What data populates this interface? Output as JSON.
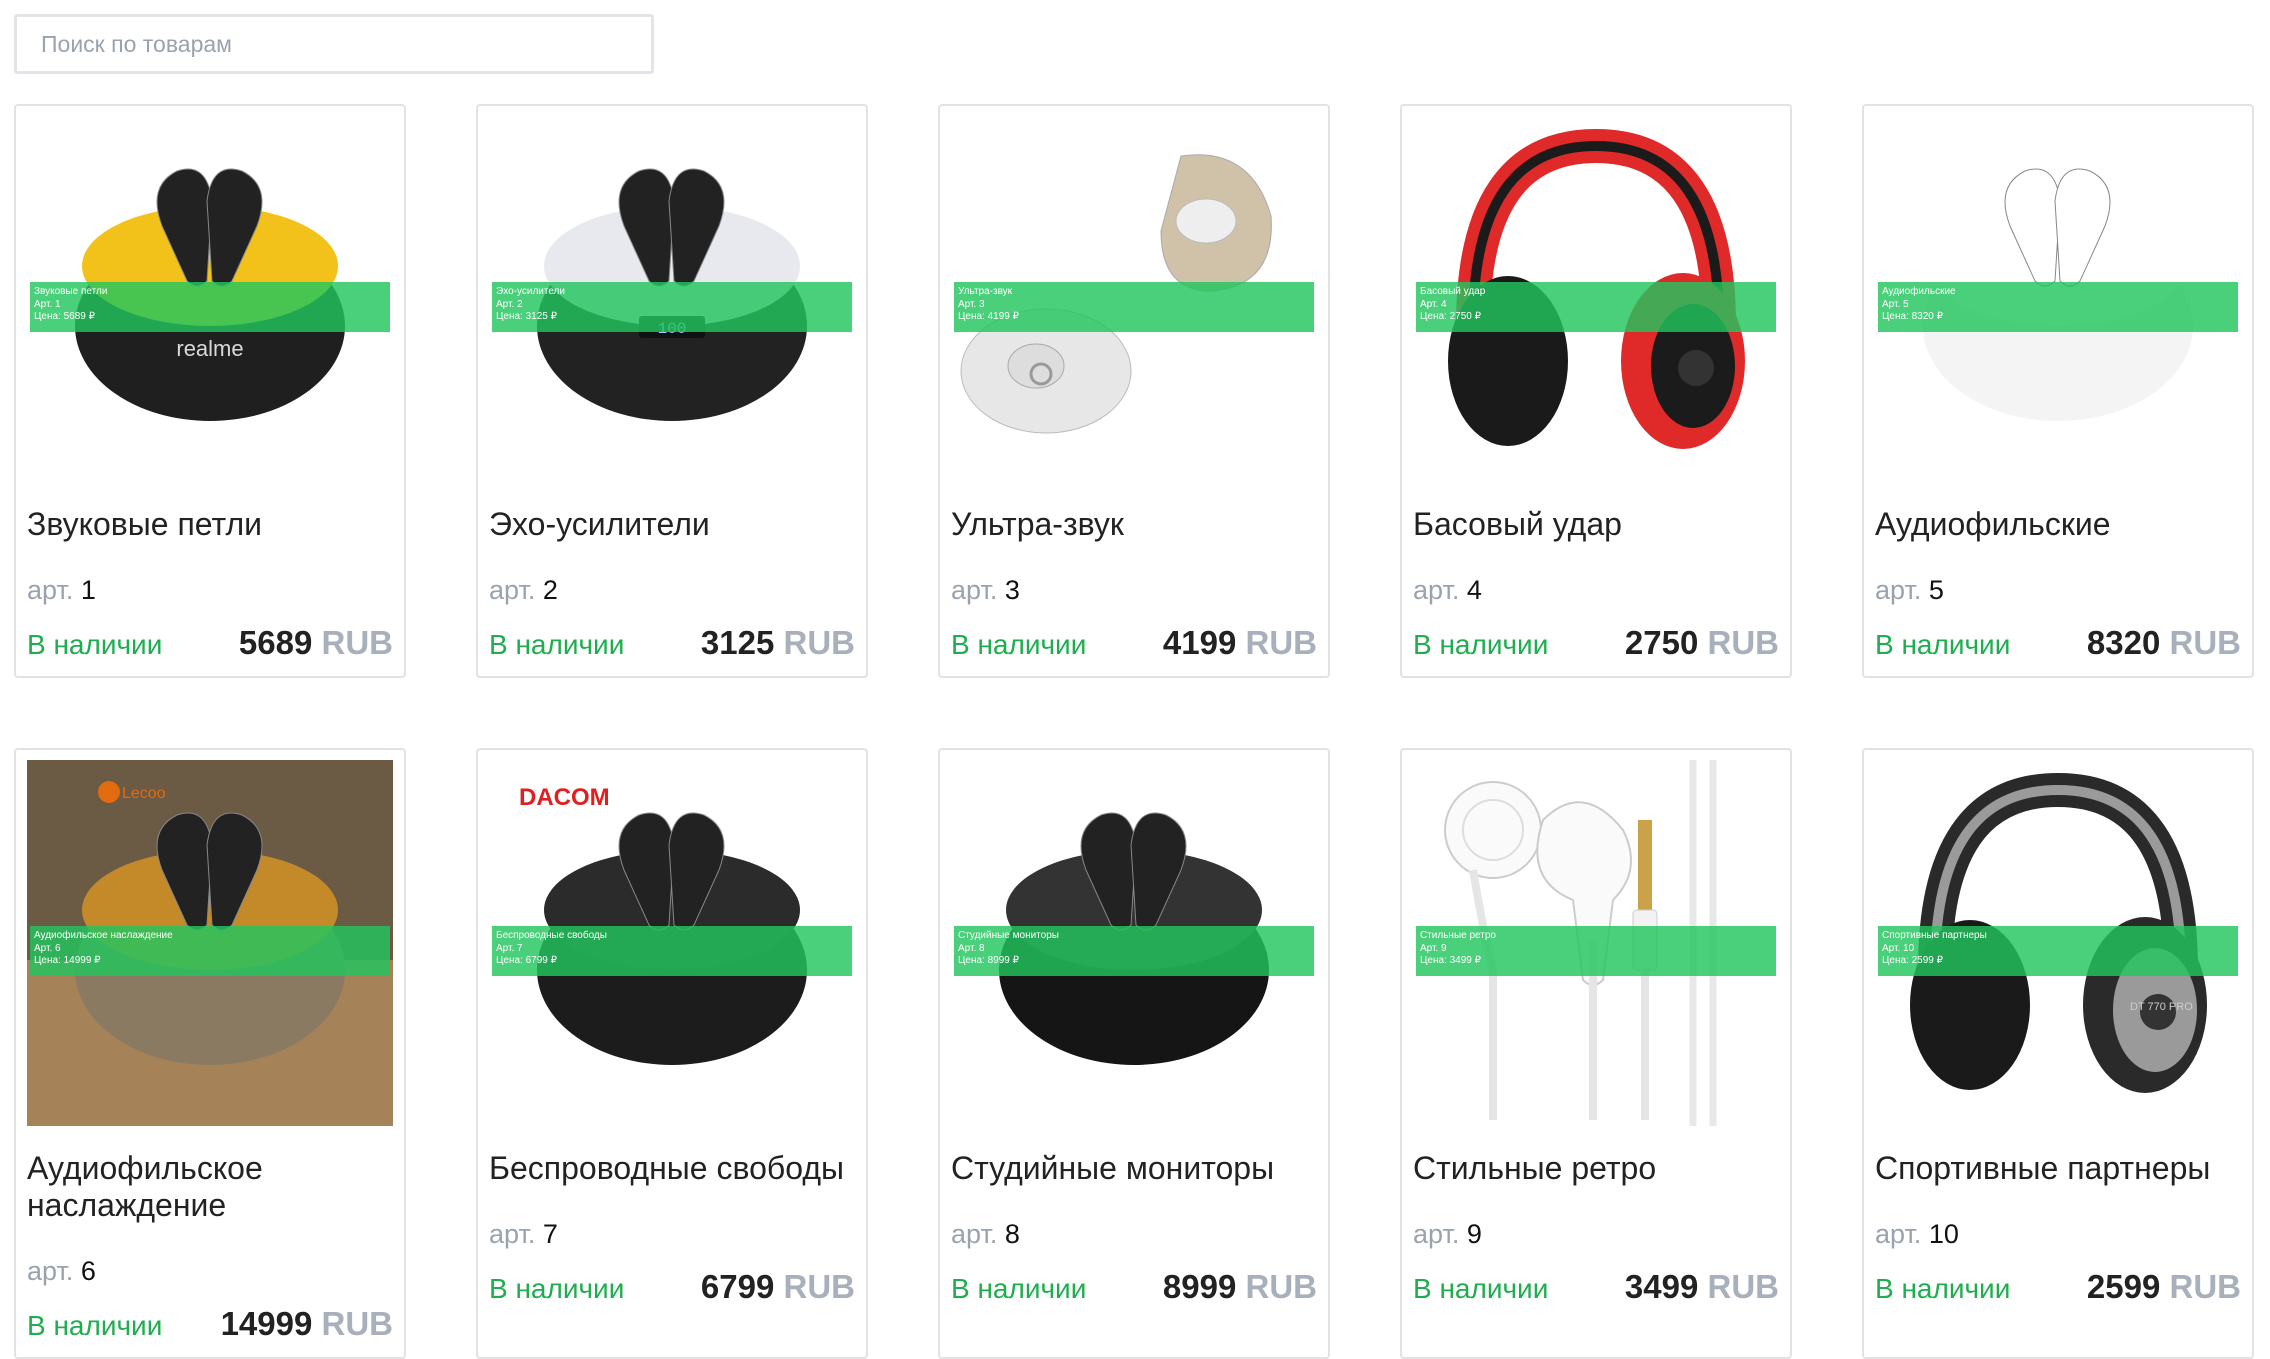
{
  "search": {
    "placeholder": "Поиск по товарам"
  },
  "labels": {
    "sku": "арт.",
    "currency": "RUB",
    "stock": "В наличии"
  },
  "products": [
    {
      "name": "Звуковые петли",
      "sku": "1",
      "price": "5689",
      "overlay": {
        "name": "Звуковые петли",
        "sku": "Арт. 1",
        "price": "Цена: 5689 ₽"
      },
      "icon": "earbuds-case-icon",
      "case_color": "#1f1f1f",
      "accent": "#f2c21b",
      "brand": "realme"
    },
    {
      "name": "Эхо-усилители",
      "sku": "2",
      "price": "3125",
      "overlay": {
        "name": "Эхо-усилители",
        "sku": "Арт. 2",
        "price": "Цена: 3125 ₽"
      },
      "icon": "earbuds-case-icon",
      "case_color": "#222222",
      "accent": "#e8e9ee",
      "display": "100"
    },
    {
      "name": "Ультра-звук",
      "sku": "3",
      "price": "4199",
      "overlay": {
        "name": "Ультра-звук",
        "sku": "Арт. 3",
        "price": "Цена: 4199 ₽"
      },
      "icon": "earbud-icon",
      "case_color": "#e7e7e7",
      "accent": "#cfc2a8"
    },
    {
      "name": "Басовый удар",
      "sku": "4",
      "price": "2750",
      "overlay": {
        "name": "Басовый удар",
        "sku": "Арт. 4",
        "price": "Цена: 2750 ₽"
      },
      "icon": "headphones-icon",
      "case_color": "#e02a2a",
      "accent": "#1b1b1b"
    },
    {
      "name": "Аудиофильские",
      "sku": "5",
      "price": "8320",
      "overlay": {
        "name": "Аудиофильские",
        "sku": "Арт. 5",
        "price": "Цена: 8320 ₽"
      },
      "icon": "earbuds-case-icon",
      "case_color": "#f4f4f4",
      "accent": "#ffffff"
    },
    {
      "name": "Аудиофильское наслаждение",
      "sku": "6",
      "price": "14999",
      "overlay": {
        "name": "Аудиофильское наслаждение",
        "sku": "Арт. 6",
        "price": "Цена: 14999 ₽"
      },
      "icon": "earbuds-case-icon",
      "case_color": "#8a7a62",
      "accent": "#c48a2a",
      "brand": "Lecoo"
    },
    {
      "name": "Беспроводные свободы",
      "sku": "7",
      "price": "6799",
      "overlay": {
        "name": "Беспроводные свободы",
        "sku": "Арт. 7",
        "price": "Цена: 6799 ₽"
      },
      "icon": "earbuds-case-icon",
      "case_color": "#1c1c1c",
      "accent": "#2b2b2b",
      "brand": "DACOM"
    },
    {
      "name": "Студийные мониторы",
      "sku": "8",
      "price": "8999",
      "overlay": {
        "name": "Студийные мониторы",
        "sku": "Арт. 8",
        "price": "Цена: 8999 ₽"
      },
      "icon": "earbuds-case-icon",
      "case_color": "#151515",
      "accent": "#333333"
    },
    {
      "name": "Стильные ретро",
      "sku": "9",
      "price": "3499",
      "overlay": {
        "name": "Стильные ретро",
        "sku": "Арт. 9",
        "price": "Цена: 3499 ₽"
      },
      "icon": "wired-earphones-icon",
      "case_color": "#f5f5f5",
      "accent": "#c9a24a"
    },
    {
      "name": "Спортивные партнеры",
      "sku": "10",
      "price": "2599",
      "overlay": {
        "name": "Спортивные партнеры",
        "sku": "Арт. 10",
        "price": "Цена: 2599 ₽"
      },
      "icon": "headphones-icon",
      "case_color": "#2a2a2a",
      "accent": "#9a9a9a",
      "label": "DT 770 PRO"
    }
  ]
}
